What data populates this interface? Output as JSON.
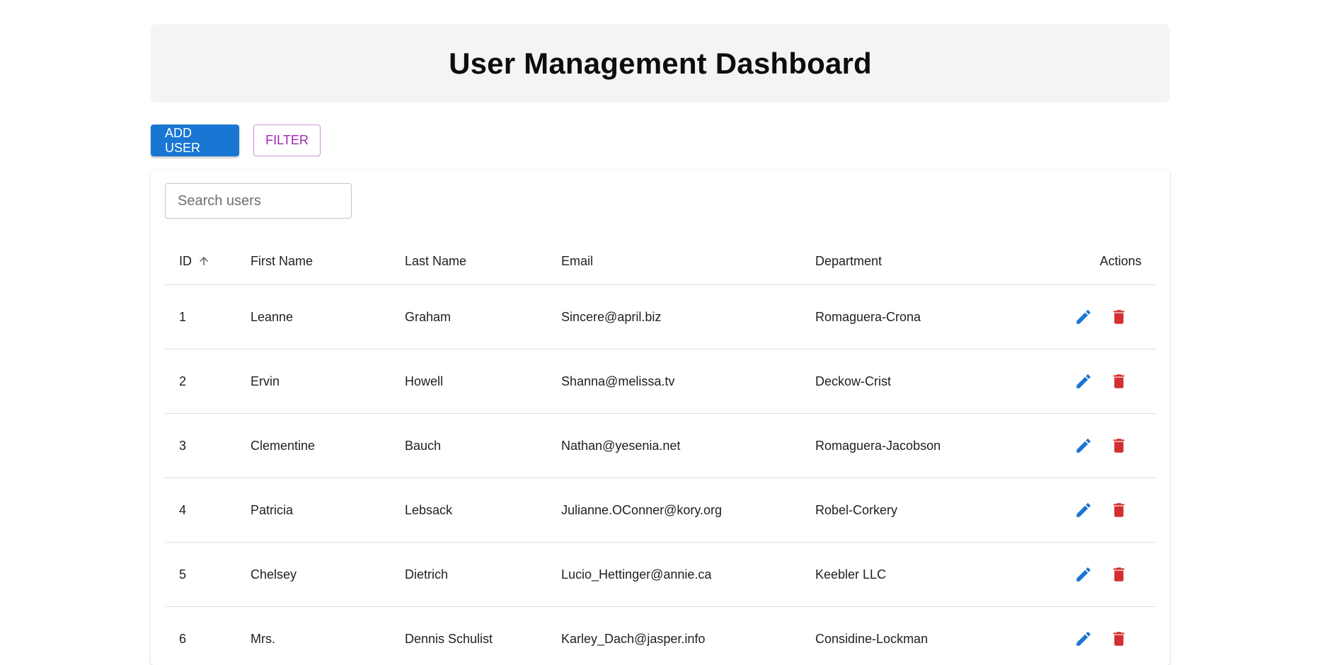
{
  "header": {
    "title": "User Management Dashboard"
  },
  "toolbar": {
    "add_label": "ADD USER",
    "filter_label": "FILTER"
  },
  "search": {
    "placeholder": "Search users",
    "value": ""
  },
  "table": {
    "columns": {
      "id": "ID",
      "first_name": "First Name",
      "last_name": "Last Name",
      "email": "Email",
      "department": "Department",
      "actions": "Actions"
    },
    "sort": {
      "column": "ID",
      "direction": "ascending"
    },
    "rows": [
      {
        "id": "1",
        "first": "Leanne",
        "last": "Graham",
        "email": "Sincere@april.biz",
        "dept": "Romaguera-Crona"
      },
      {
        "id": "2",
        "first": "Ervin",
        "last": "Howell",
        "email": "Shanna@melissa.tv",
        "dept": "Deckow-Crist"
      },
      {
        "id": "3",
        "first": "Clementine",
        "last": "Bauch",
        "email": "Nathan@yesenia.net",
        "dept": "Romaguera-Jacobson"
      },
      {
        "id": "4",
        "first": "Patricia",
        "last": "Lebsack",
        "email": "Julianne.OConner@kory.org",
        "dept": "Robel-Corkery"
      },
      {
        "id": "5",
        "first": "Chelsey",
        "last": "Dietrich",
        "email": "Lucio_Hettinger@annie.ca",
        "dept": "Keebler LLC"
      },
      {
        "id": "6",
        "first": "Mrs.",
        "last": "Dennis Schulist",
        "email": "Karley_Dach@jasper.info",
        "dept": "Considine-Lockman"
      }
    ]
  },
  "icons": {
    "sort": "arrow-up-icon",
    "edit": "pencil-icon",
    "delete": "trash-icon"
  },
  "colors": {
    "primary": "#1976d2",
    "secondary": "#9c27b0",
    "danger": "#d32f2f",
    "header_bg": "#f4f4f4"
  }
}
